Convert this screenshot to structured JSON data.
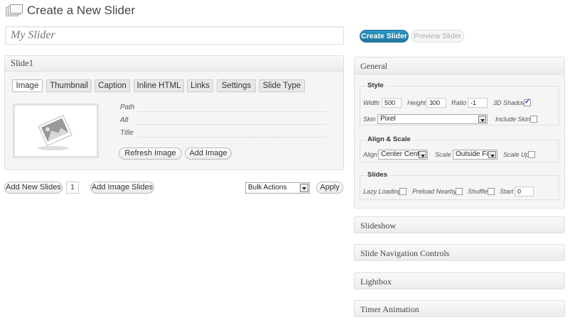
{
  "header": {
    "title": "Create a New Slider",
    "icon": "slides-stack-icon"
  },
  "title_input": {
    "value": "My Slider"
  },
  "slide": {
    "title": "Slide1",
    "tabs": [
      "Image",
      "Thumbnail",
      "Caption",
      "Inline HTML",
      "Links",
      "Settings",
      "Slide Type"
    ],
    "active_tab": "Image",
    "fields": [
      {
        "label": "Path"
      },
      {
        "label": "Alt"
      },
      {
        "label": "Title"
      }
    ],
    "refresh_label": "Refresh Image",
    "add_image_label": "Add Image"
  },
  "actions": {
    "add_new_slides": "Add New Slides",
    "count": "1",
    "add_image_slides": "Add Image Slides",
    "bulk_actions": "Bulk Actions",
    "apply": "Apply"
  },
  "sidebar": {
    "create_label": "Create Slider",
    "preview_label": "Preview Slider",
    "accent": "#21759b",
    "general": {
      "title": "General",
      "style": {
        "title": "Style",
        "width_label": "Width",
        "width": "500",
        "height_label": "Height",
        "height": "300",
        "ratio_label": "Ratio",
        "ratio": "-1",
        "shadow_label": "3D Shadow",
        "shadow_checked": true,
        "skin_label": "Skin",
        "skin": "Pixel",
        "include_skin_label": "Include Skin",
        "include_skin_checked": false
      },
      "align": {
        "title": "Align & Scale",
        "align_label": "Align",
        "align": "Center Center",
        "scale_label": "Scale",
        "scale": "Outside Fit",
        "scale_up_label": "Scale Up",
        "scale_up_checked": false
      },
      "slides": {
        "title": "Slides",
        "lazy_label": "Lazy Loading",
        "preload_label": "Preload Nearby",
        "shuffle_label": "Shuffle",
        "start_label": "Start",
        "start": "0"
      }
    },
    "panels": [
      "Slideshow",
      "Slide Navigation Controls",
      "Lightbox",
      "Timer Animation"
    ]
  }
}
